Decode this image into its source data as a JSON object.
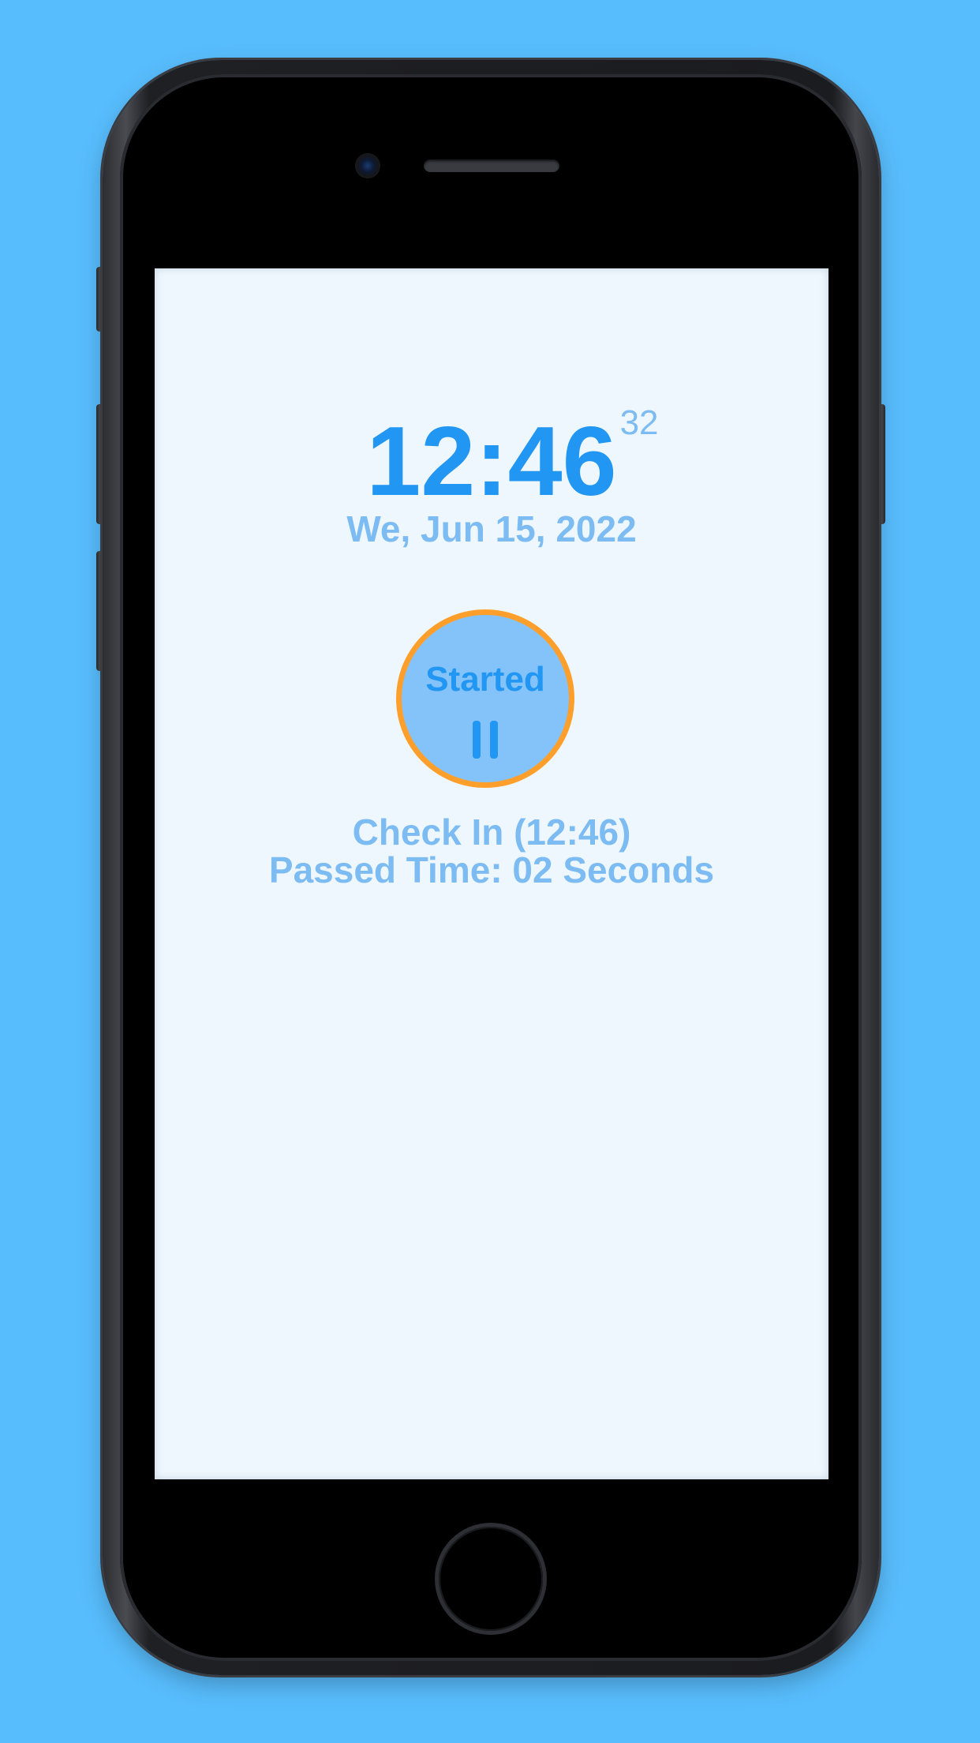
{
  "clock": {
    "time": "12:46",
    "seconds": "32",
    "date": "We, Jun 15, 2022"
  },
  "status_button": {
    "label": "Started",
    "icon": "pause-icon",
    "ring_color": "#ff9f2b",
    "fill_color": "#84c3f9"
  },
  "check_in": {
    "text": "Check In (12:46)"
  },
  "passed_time": {
    "text": "Passed Time: 02 Seconds"
  },
  "colors": {
    "background": "#58bdfd",
    "accent": "#2196f3",
    "muted_text": "#7cbcf3",
    "screen": "#eff7fe"
  }
}
